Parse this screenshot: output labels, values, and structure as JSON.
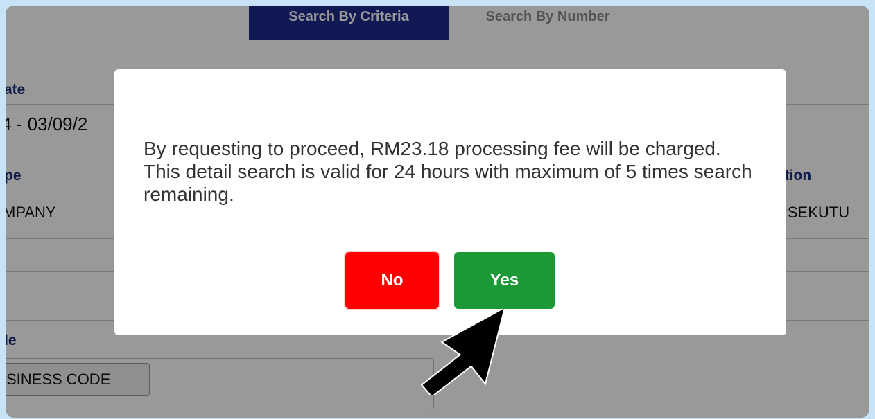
{
  "tabs": {
    "criteria_label": "Search By Criteria",
    "number_label": "Search By Number"
  },
  "form": {
    "date_label": "ate",
    "date_value": "4 - 03/09/2",
    "type_label": "pe",
    "type_value": "MPANY",
    "location_label": "ation",
    "location_value": "RSEKUTU",
    "code_label": "le",
    "code_button": "SINESS CODE"
  },
  "dialog": {
    "message": "By requesting to proceed, RM23.18 processing fee will be charged. This detail search is valid for 24 hours with maximum of 5 times search remaining.",
    "no_label": "No",
    "yes_label": "Yes"
  },
  "colors": {
    "tab_active": "#1c2a8c",
    "no_button": "#ff0000",
    "yes_button": "#1a9936",
    "label_text": "#1d2b7a"
  }
}
